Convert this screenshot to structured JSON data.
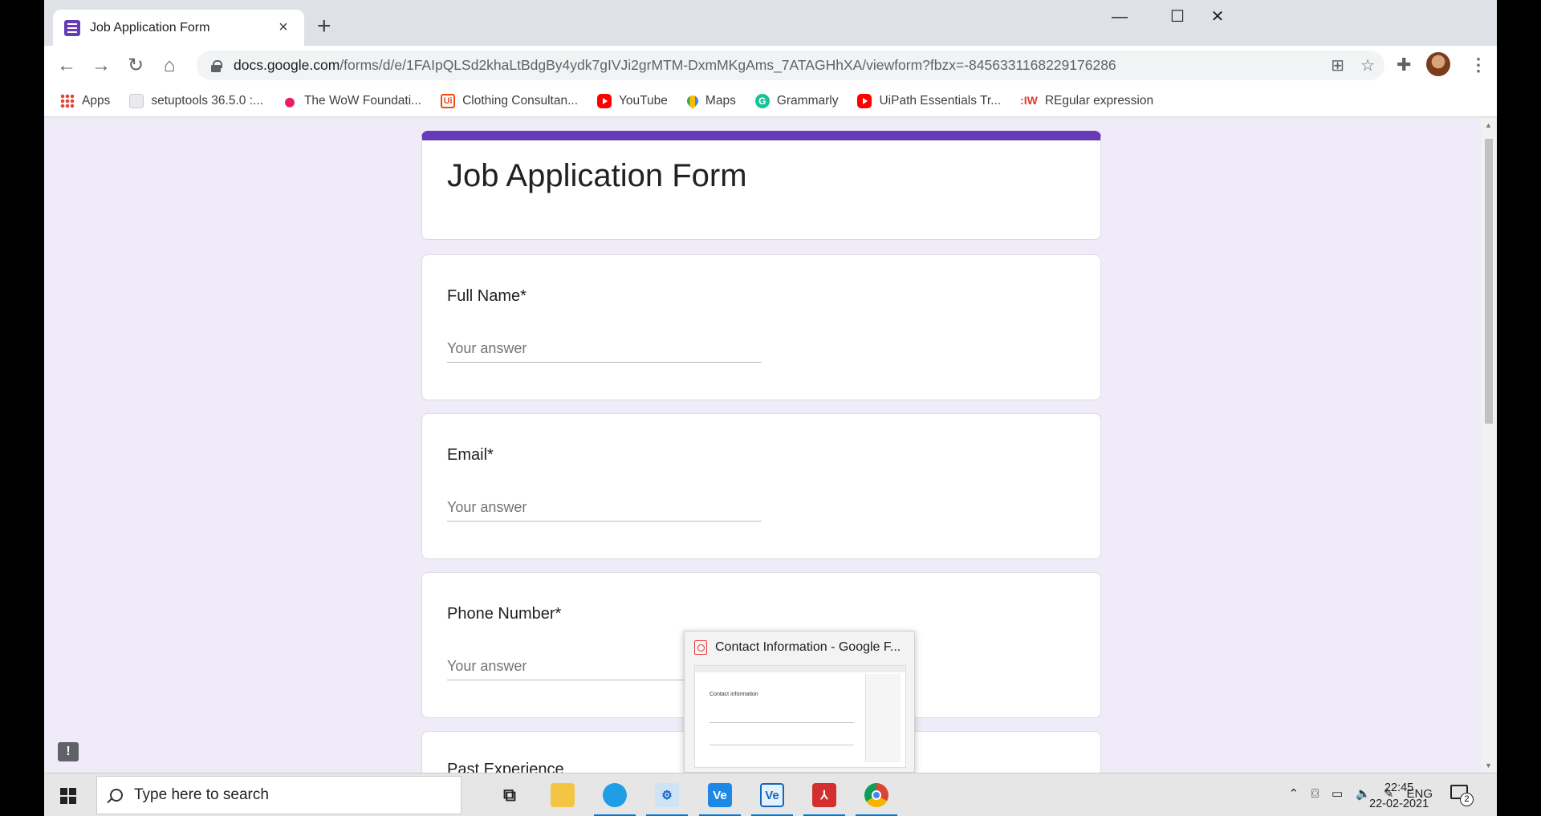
{
  "browser": {
    "tab_title": "Job Application Form",
    "tab_close": "×",
    "new_tab": "+",
    "window_controls": {
      "minimize": "—",
      "maximize": "☐",
      "close": "✕"
    },
    "url_host": "docs.google.com",
    "url_path": "/forms/d/e/1FAIpQLSd2khaLtBdgBy4ydk7gIVJi2grMTM-DxmMKgAms_7ATAGHhXA/viewform?fbzx=-8456331168229176286",
    "nav": {
      "back": "←",
      "forward": "→",
      "reload": "↻",
      "home": "⌂"
    },
    "bookmarks": [
      {
        "label": "Apps",
        "icon": "apps-grid-icon"
      },
      {
        "label": "setuptools 36.5.0 :...",
        "icon": "page-icon"
      },
      {
        "label": "The WoW Foundati...",
        "icon": "wow-icon"
      },
      {
        "label": "Clothing Consultan...",
        "icon": "ui-icon"
      },
      {
        "label": "YouTube",
        "icon": "youtube-icon"
      },
      {
        "label": "Maps",
        "icon": "maps-icon"
      },
      {
        "label": "Grammarly",
        "icon": "grammarly-icon"
      },
      {
        "label": "UiPath Essentials Tr...",
        "icon": "youtube-icon"
      },
      {
        "label": "REgular expression",
        "icon": "iw-icon"
      }
    ]
  },
  "form": {
    "title": "Job Application Form",
    "accent_color": "#673ab7",
    "questions": [
      {
        "label": "Full Name*",
        "placeholder": "Your answer"
      },
      {
        "label": "Email*",
        "placeholder": "Your answer"
      },
      {
        "label": "Phone Number*",
        "placeholder": "Your answer"
      },
      {
        "label": "Past Experience"
      }
    ]
  },
  "thumbnail_preview": {
    "title": "Contact Information - Google F...",
    "preview_heading": "Contact information"
  },
  "taskbar": {
    "search_placeholder": "Type here to search",
    "language": "ENG",
    "time": "22:45",
    "date": "22-02-2021",
    "notification_count": "2"
  }
}
